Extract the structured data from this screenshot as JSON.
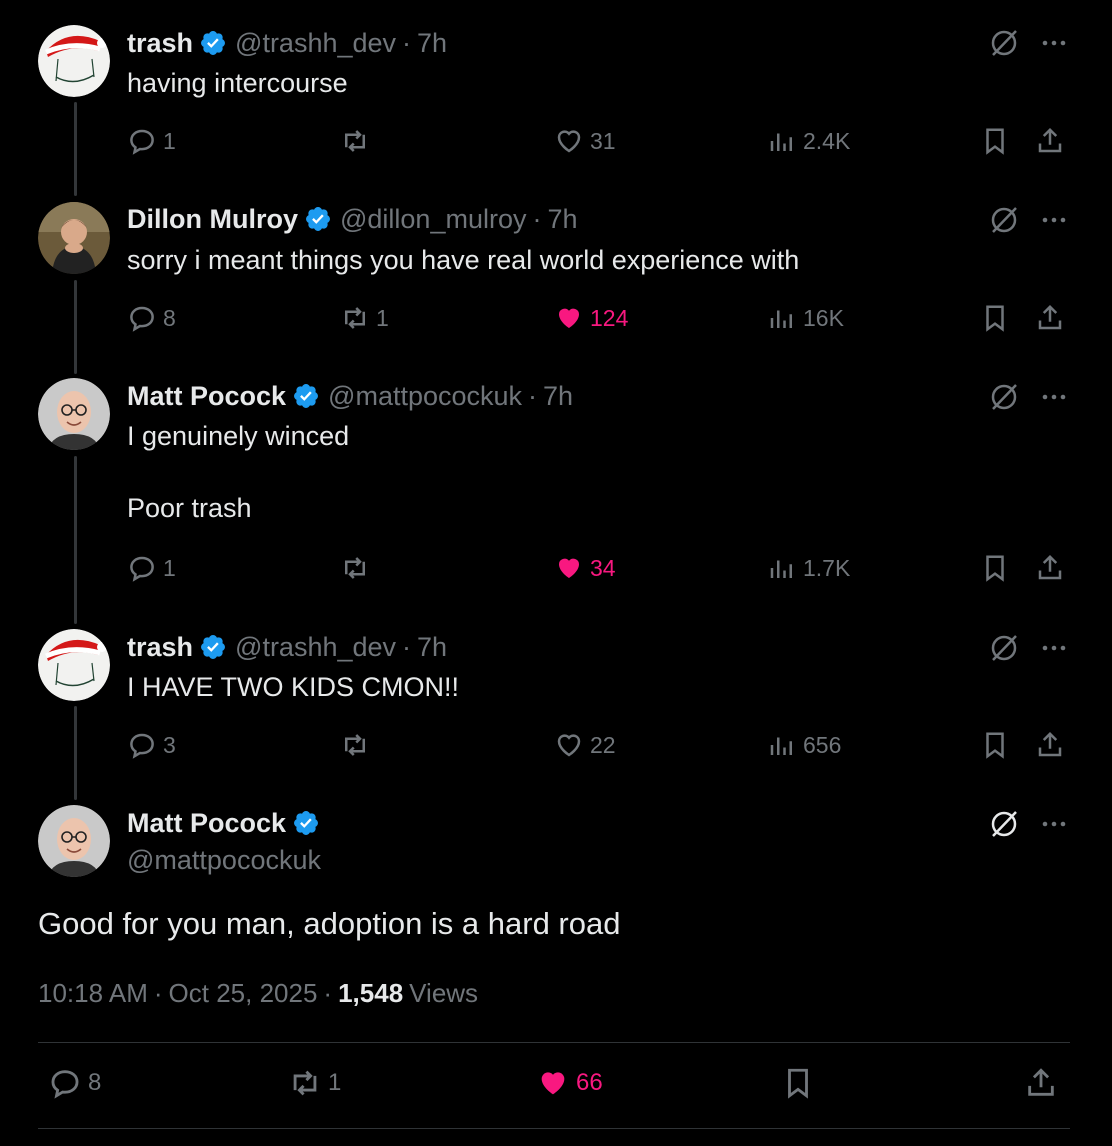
{
  "tweets": [
    {
      "name": "trash",
      "handle": "@trashh_dev",
      "sep": "·",
      "time": "7h",
      "text": "having intercourse",
      "replies": "1",
      "reposts": "",
      "likes": "31",
      "views": "2.4K",
      "liked": false
    },
    {
      "name": "Dillon Mulroy",
      "handle": "@dillon_mulroy",
      "sep": "·",
      "time": "7h",
      "text": "sorry i meant things you have real world experience with",
      "replies": "8",
      "reposts": "1",
      "likes": "124",
      "views": "16K",
      "liked": true
    },
    {
      "name": "Matt Pocock",
      "handle": "@mattpocockuk",
      "sep": "·",
      "time": "7h",
      "text": "I genuinely winced\n\nPoor trash",
      "replies": "1",
      "reposts": "",
      "likes": "34",
      "views": "1.7K",
      "liked": true
    },
    {
      "name": "trash",
      "handle": "@trashh_dev",
      "sep": "·",
      "time": "7h",
      "text": "I HAVE TWO KIDS CMON!!",
      "replies": "3",
      "reposts": "",
      "likes": "22",
      "views": "656",
      "liked": false
    }
  ],
  "main": {
    "name": "Matt Pocock",
    "handle": "@mattpocockuk",
    "text": "Good for you man, adoption is a hard road",
    "time": "10:18 AM",
    "sep1": "·",
    "date": "Oct 25, 2025",
    "sep2": "·",
    "views_count": "1,548",
    "views_label": "Views",
    "replies": "8",
    "reposts": "1",
    "likes": "66",
    "liked": true
  },
  "colors": {
    "background": "#000000",
    "text": "#e7e9ea",
    "muted": "#71767b",
    "like": "#f91880",
    "verified": "#1d9bf0"
  }
}
